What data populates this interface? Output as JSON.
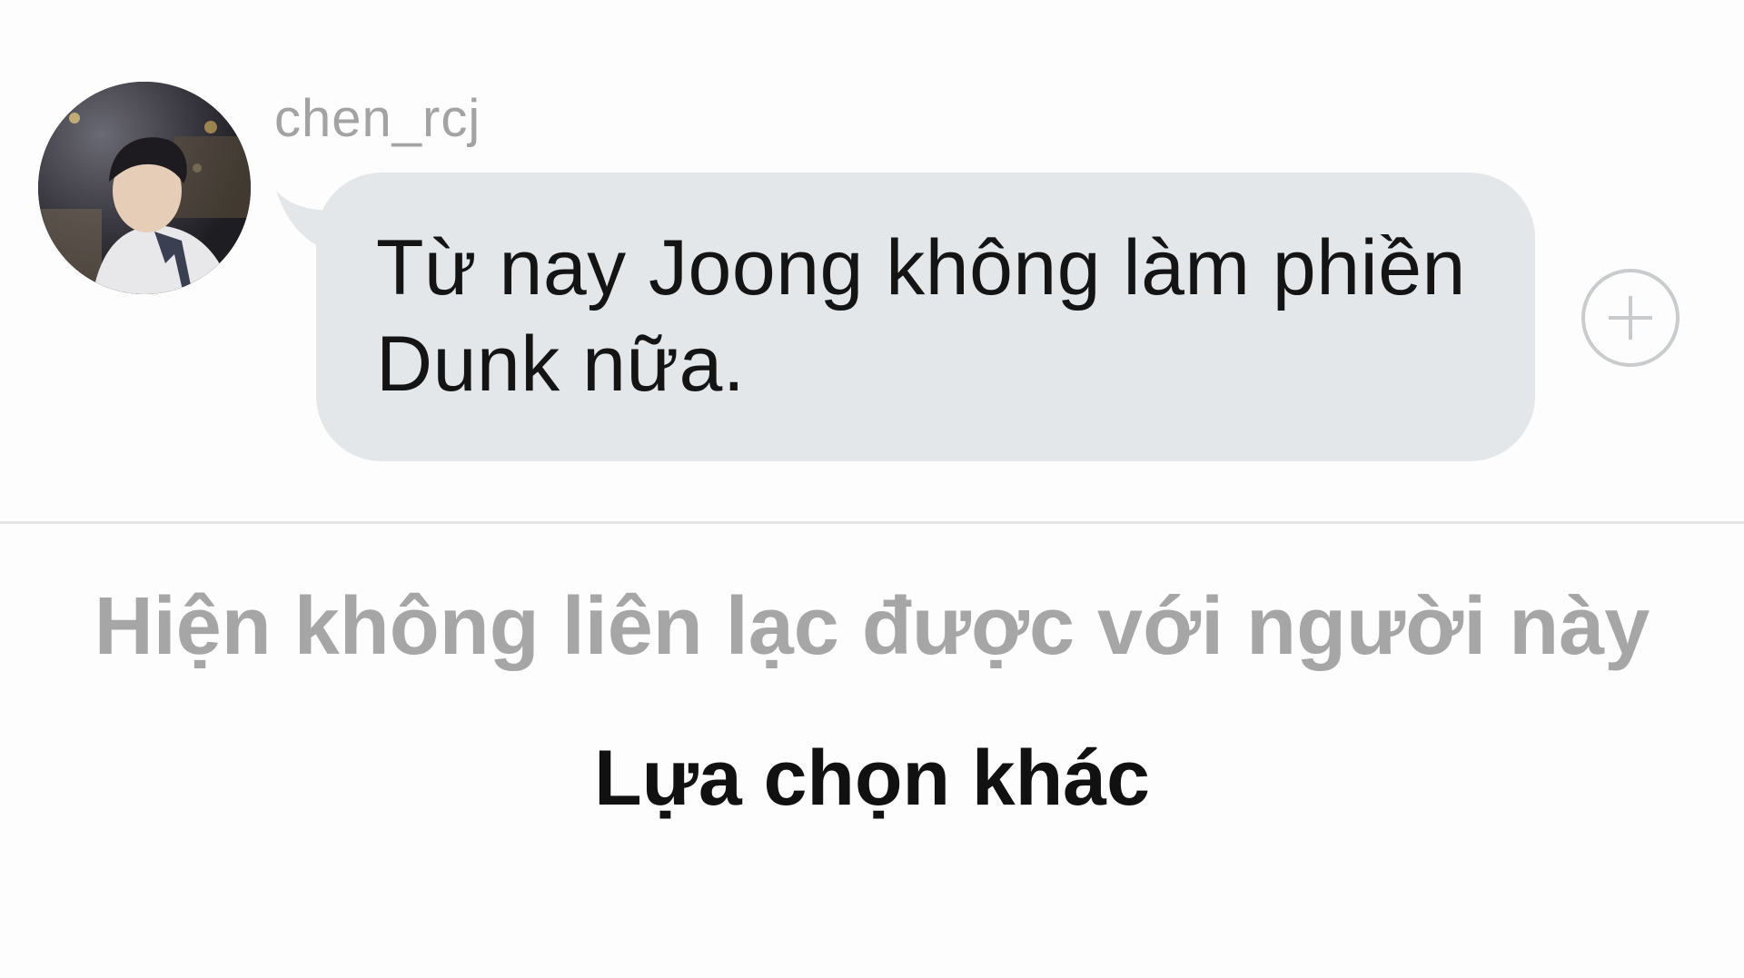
{
  "conversation": {
    "sender": {
      "username": "chen_rcj",
      "avatar": "profile-photo"
    },
    "message": {
      "text": "Từ nay Joong không làm phiền Dunk nữa."
    },
    "add_reaction_icon": "plus-circle-icon"
  },
  "footer": {
    "status_text": "Hiện không liên lạc được với người này",
    "options_label": "Lựa chọn khác"
  },
  "colors": {
    "bubble_background": "#e4e7ea",
    "status_text": "#a6a6a6",
    "username_text": "#a3a3a3"
  }
}
